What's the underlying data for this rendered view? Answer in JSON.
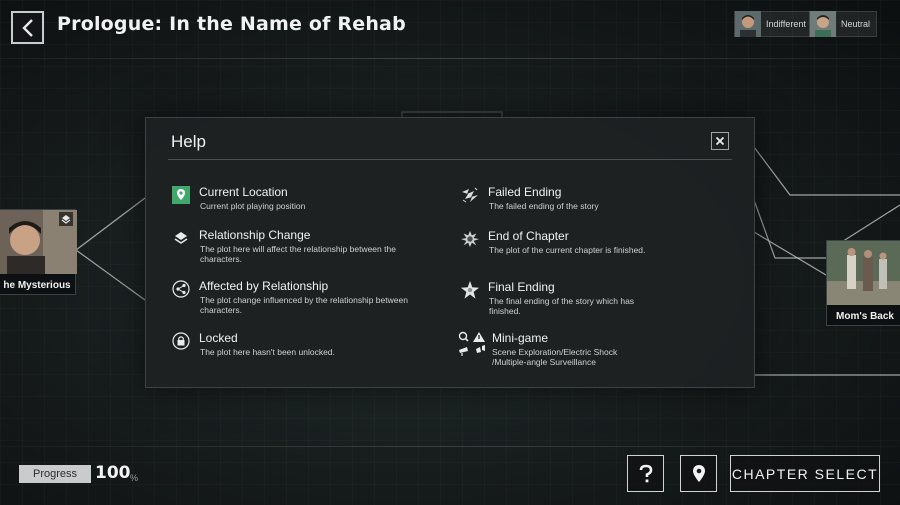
{
  "header": {
    "title": "Prologue: In the Name of Rehab",
    "statuses": [
      {
        "label": "Indifferent",
        "avatar_icon": "character-portrait-icon"
      },
      {
        "label": "Neutral",
        "avatar_icon": "character-portrait-icon"
      }
    ]
  },
  "story_map": {
    "nodes": [
      {
        "label": "he Mysterious",
        "badge_icon": "relationship-change-icon"
      },
      {
        "label": "Mom's Back"
      }
    ]
  },
  "footer": {
    "progress_label": "Progress",
    "progress_value": "100",
    "progress_unit": "%",
    "help_icon": "question-mark-icon",
    "location_icon": "location-pin-icon",
    "chapter_select_label": "CHAPTER SELECT"
  },
  "help": {
    "title": "Help",
    "close_icon": "close-icon",
    "left_items": [
      {
        "icon": "current-location-icon",
        "name": "Current Location",
        "desc": "Current plot playing position"
      },
      {
        "icon": "relationship-change-icon",
        "name": "Relationship Change",
        "desc": "The plot here will affect the relationship between the characters."
      },
      {
        "icon": "affected-by-relationship-icon",
        "name": "Affected by Relationship",
        "desc": "The plot change influenced by the relationship between characters."
      },
      {
        "icon": "lock-icon",
        "name": "Locked",
        "desc": "The plot here hasn't been unlocked."
      }
    ],
    "right_items": [
      {
        "icon": "failed-ending-icon",
        "name": "Failed Ending",
        "desc": "The failed ending of the story"
      },
      {
        "icon": "end-of-chapter-icon",
        "name": "End of Chapter",
        "desc": "The plot of the current chapter is finished."
      },
      {
        "icon": "final-ending-icon",
        "name": "Final Ending",
        "desc": "The final ending of the story which has finished."
      },
      {
        "icon": "mini-game-icon",
        "name": "Mini-game",
        "desc": "Scene Exploration/Electric Shock /Multiple-angle Surveillance"
      }
    ]
  },
  "colors": {
    "accent_green": "#3fa86a",
    "modal_bg": "#1e2122",
    "text_primary": "#f1f2f3"
  }
}
